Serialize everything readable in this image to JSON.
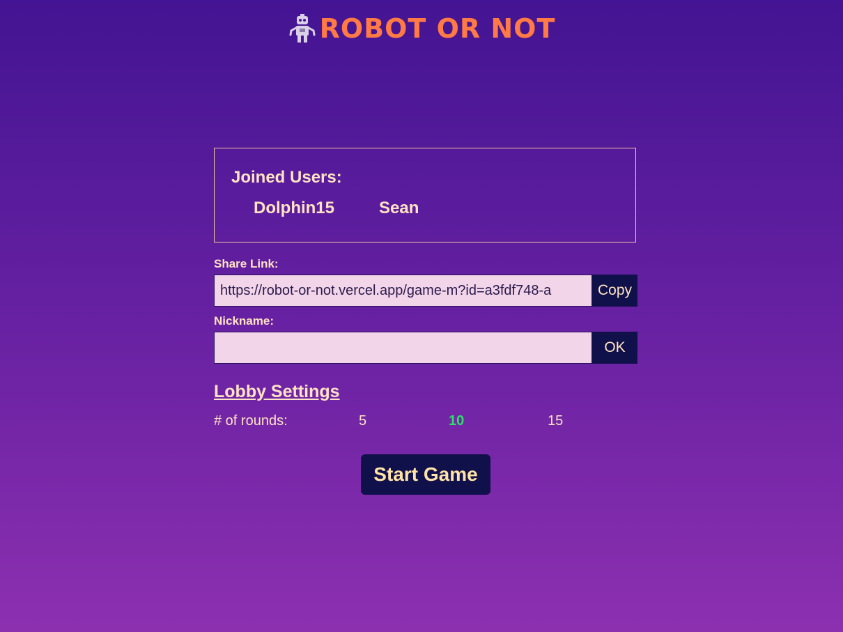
{
  "header": {
    "title": "ROBOT OR NOT",
    "logo_icon": "robot-icon",
    "title_color": "#ff7a45"
  },
  "joined_users": {
    "heading": "Joined Users:",
    "users": [
      "Dolphin15",
      "Sean"
    ]
  },
  "share_link": {
    "label": "Share Link:",
    "value": "https://robot-or-not.vercel.app/game-m?id=a3fdf748-a",
    "button_label": "Copy"
  },
  "nickname": {
    "label": "Nickname:",
    "value": "",
    "placeholder": "",
    "button_label": "OK"
  },
  "lobby_settings": {
    "title": "Lobby Settings",
    "rounds_label": "# of rounds:",
    "round_options": [
      "5",
      "10",
      "15"
    ],
    "selected_round": "10",
    "selected_color": "#2ee06a"
  },
  "start_button": {
    "label": "Start Game"
  },
  "colors": {
    "background_top": "#431493",
    "background_bottom": "#8c30b0",
    "text": "#ffe3c4",
    "button_bg": "#10104a",
    "input_bg": "#f3d5ea"
  }
}
